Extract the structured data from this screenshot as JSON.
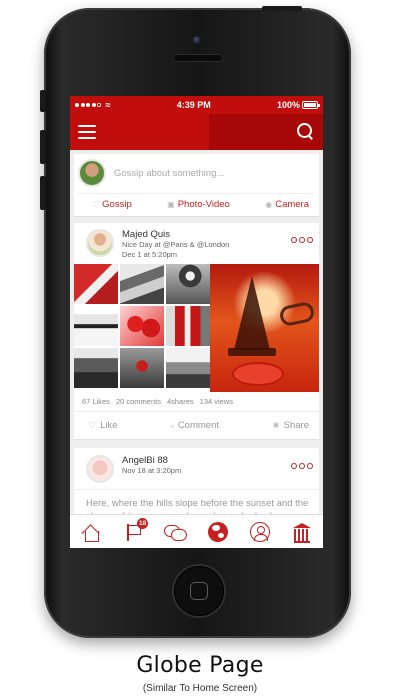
{
  "status_bar": {
    "time": "4:39 PM",
    "battery": "100%",
    "wifi_icon": "wifi-icon"
  },
  "nav": {
    "menu_icon": "hamburger-menu-icon",
    "search_icon": "search-icon"
  },
  "composer": {
    "placeholder": "Gossip about something...",
    "actions": [
      {
        "label": "Gossip",
        "icon": "heart-icon"
      },
      {
        "label": "Photo-Video",
        "icon": "photo-icon"
      },
      {
        "label": "Camera",
        "icon": "camera-icon"
      }
    ]
  },
  "posts": [
    {
      "author": "Majed Quis",
      "line1": "Nice Day at @Paris & @London",
      "line2": "Dec 1 at 5:20pm",
      "stats": {
        "likes": "67 Likes",
        "comments": "20 comments",
        "shares": "4shares",
        "views": "134 views"
      },
      "actions": [
        {
          "label": "Like",
          "icon": "heart-icon"
        },
        {
          "label": "Comment",
          "icon": "comment-icon"
        },
        {
          "label": "Share",
          "icon": "share-icon"
        }
      ]
    },
    {
      "author": "AngelBi 88",
      "line1": "Nov 18 at 3:20pm",
      "text": "Here, where the hills slope before the sunset and the chasm of time near gardens whose shades have leave..."
    }
  ],
  "tabbar": {
    "tabs": [
      {
        "name": "home",
        "icon": "home-icon"
      },
      {
        "name": "notifications",
        "icon": "flag-icon",
        "badge": "18"
      },
      {
        "name": "messages",
        "icon": "chat-icon"
      },
      {
        "name": "globe",
        "icon": "globe-icon",
        "active": true
      },
      {
        "name": "profile",
        "icon": "user-icon"
      },
      {
        "name": "places",
        "icon": "museum-icon"
      }
    ]
  },
  "caption": {
    "title": "Globe Page",
    "subtitle": "(Similar To Home Screen)"
  },
  "colors": {
    "brand_red": "#c20d0d",
    "accent_red": "#c82020",
    "feed_bg": "#eeeeee"
  }
}
